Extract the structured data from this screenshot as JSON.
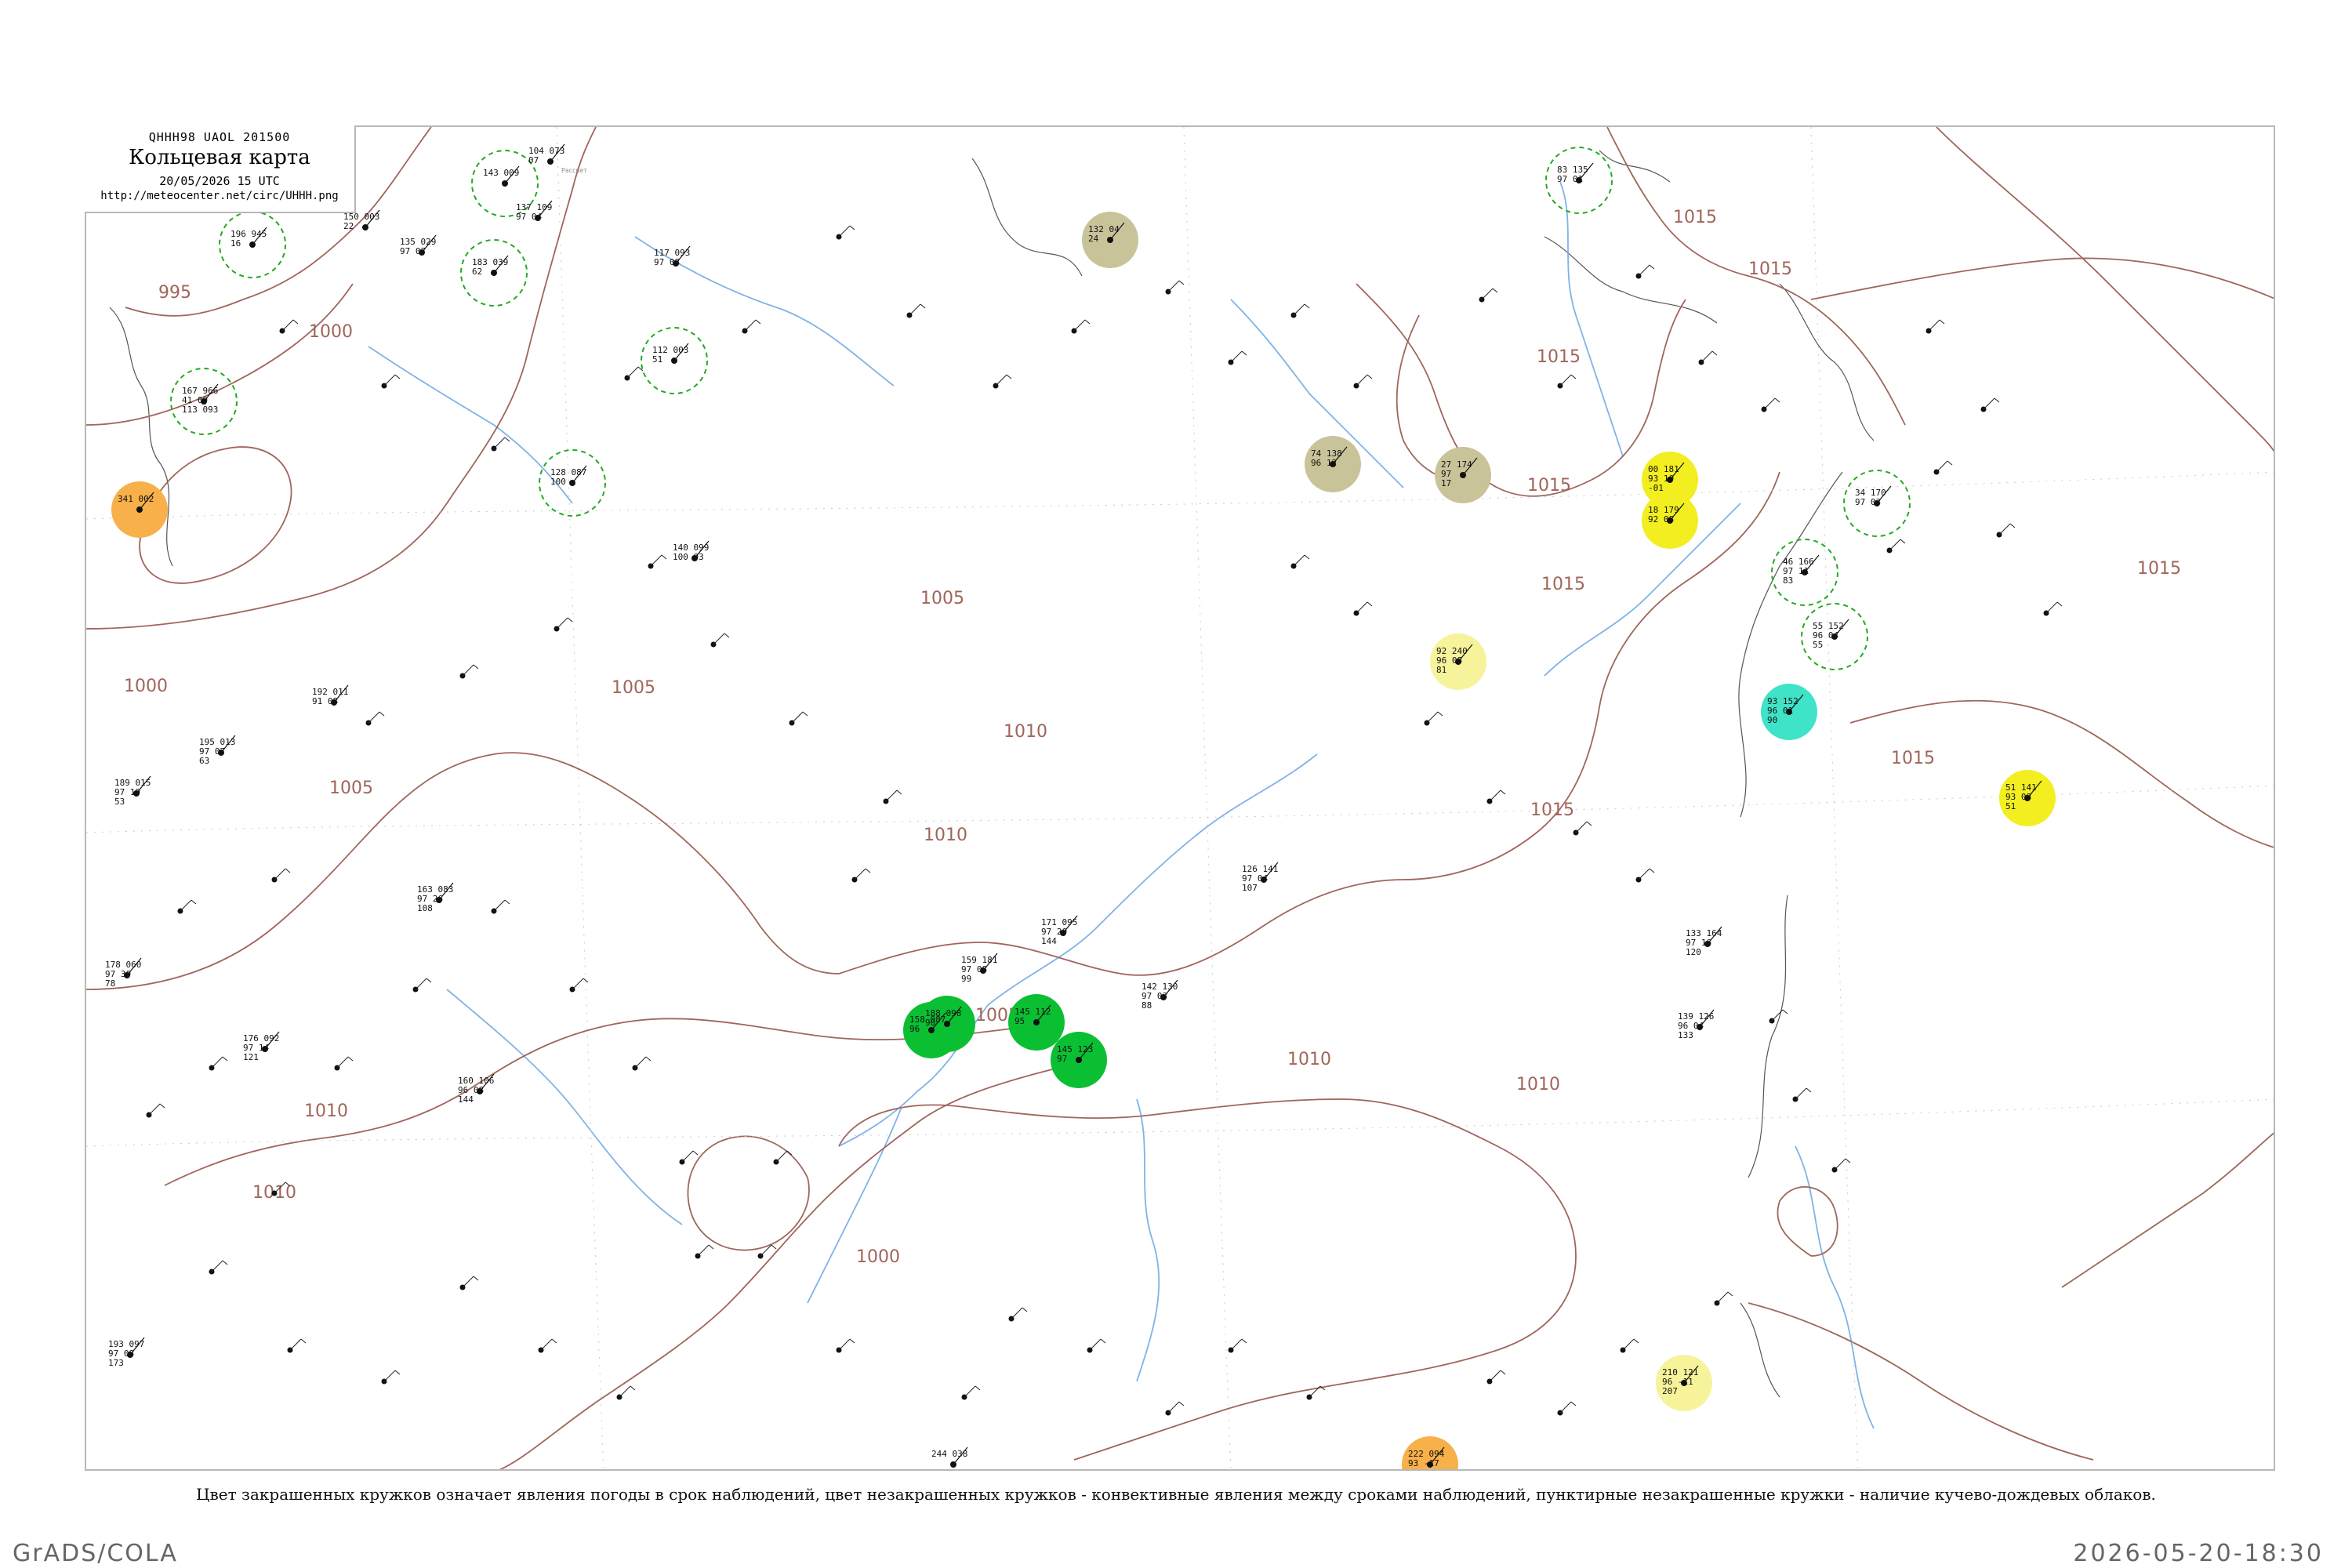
{
  "header": {
    "code": "QHHH98  UAOL  201500",
    "title": "Кольцевая карта",
    "datetime": "20/05/2026 15 UTC",
    "url": "http://meteocenter.net/circ/UHHH.png"
  },
  "caption": "Цвет закрашенных кружков означает явления погоды в срок наблюдений, цвет незакрашенных кружков - конвективные явления между сроками наблюдений, пунктирные незакрашенные кружки - наличие кучево-дождевых облаков.",
  "footer": {
    "left": "GrADS/COLA",
    "right": "2026-05-20-18:30"
  },
  "colors": {
    "isobar": "#a0655a",
    "river": "#7fb3e6",
    "coast": "#555555",
    "rain": "#0bbf32",
    "fog": "#c9c39a",
    "haze": "#f7f39a",
    "snow": "#f2ee20",
    "orange": "#f7b04a",
    "cyan": "#3fe3c8",
    "cb_outline": "#22aa22"
  },
  "isobar_labels": [
    "995",
    "1000",
    "1000",
    "1005",
    "1005",
    "1005",
    "1005",
    "1010",
    "1010",
    "1010",
    "1010",
    "1010",
    "1010",
    "1015",
    "1015",
    "1015",
    "1015",
    "1015",
    "1015",
    "1015",
    "1015",
    "1000"
  ],
  "stations": [
    {
      "id": "s01",
      "line1": "341 002",
      "line2": "",
      "line3": "",
      "name": "",
      "weather": "orange"
    },
    {
      "id": "s02",
      "line1": "196 945",
      "line2": "16",
      "line3": "",
      "name": "",
      "weather": "cb"
    },
    {
      "id": "s03",
      "line1": "143 009",
      "line2": "",
      "line3": "",
      "name": "",
      "weather": "cb"
    },
    {
      "id": "s04",
      "line1": "183 039",
      "line2": "62",
      "line3": "",
      "name": "",
      "weather": "cb"
    },
    {
      "id": "s05",
      "line1": "167 966",
      "line2": "41 09",
      "line3": "113 093",
      "name": "",
      "weather": "cb"
    },
    {
      "id": "s06",
      "line1": "112 003",
      "line2": "51",
      "line3": "",
      "name": "",
      "weather": "cb"
    },
    {
      "id": "s07",
      "line1": "128 087",
      "line2": "100",
      "line3": "",
      "name": "",
      "weather": "cb"
    },
    {
      "id": "s08",
      "line1": "132 04",
      "line2": "24",
      "line3": "",
      "name": "",
      "weather": "fog"
    },
    {
      "id": "s09",
      "line1": "74 138",
      "line2": "96 12",
      "line3": "",
      "name": "",
      "weather": "fog"
    },
    {
      "id": "s10",
      "line1": "27 174",
      "line2": "97",
      "line3": "17",
      "name": "",
      "weather": "fog"
    },
    {
      "id": "s11",
      "line1": "83 135",
      "line2": "97 01",
      "line3": "",
      "name": "",
      "weather": "cb"
    },
    {
      "id": "s12",
      "line1": "00 181",
      "line2": "93 10",
      "line3": "-01",
      "name": "",
      "weather": "snow"
    },
    {
      "id": "s13",
      "line1": "18 179",
      "line2": "92 08",
      "line3": "",
      "name": "",
      "weather": "snow"
    },
    {
      "id": "s14",
      "line1": "34 170",
      "line2": "97 03",
      "line3": "",
      "name": "",
      "weather": "cb"
    },
    {
      "id": "s15",
      "line1": "46 166",
      "line2": "97 11",
      "line3": "83",
      "name": "",
      "weather": "cb"
    },
    {
      "id": "s16",
      "line1": "55 152",
      "line2": "96 04",
      "line3": "55",
      "name": "",
      "weather": "cb"
    },
    {
      "id": "s17",
      "line1": "92 240",
      "line2": "96 08",
      "line3": "81",
      "name": "",
      "weather": "haze"
    },
    {
      "id": "s18",
      "line1": "93 152",
      "line2": "96 01",
      "line3": "90",
      "name": "",
      "weather": "cyan"
    },
    {
      "id": "s19",
      "line1": "51 141",
      "line2": "93 08",
      "line3": "51",
      "name": "",
      "weather": "snow"
    },
    {
      "id": "s20",
      "line1": "210 121",
      "line2": "96 -11",
      "line3": "207",
      "name": "",
      "weather": "haze"
    },
    {
      "id": "s21",
      "line1": "222 094",
      "line2": "93 -17",
      "line3": "",
      "name": "",
      "weather": "orange"
    },
    {
      "id": "s22",
      "line1": "188 098",
      "line2": "90",
      "line3": "",
      "name": "",
      "weather": "rain"
    },
    {
      "id": "s23",
      "line1": "158 087",
      "line2": "96",
      "line3": "",
      "name": "",
      "weather": "rain"
    },
    {
      "id": "s24",
      "line1": "145 123",
      "line2": "97",
      "line3": "",
      "name": "",
      "weather": "rain"
    },
    {
      "id": "s25",
      "line1": "171 095",
      "line2": "97 20",
      "line3": "144",
      "name": "",
      "weather": "none"
    },
    {
      "id": "s26",
      "line1": "159 181",
      "line2": "97 08",
      "line3": "99",
      "name": "",
      "weather": "none"
    },
    {
      "id": "s27",
      "line1": "145 112",
      "line2": "95",
      "line3": "",
      "name": "",
      "weather": "rain"
    },
    {
      "id": "s28",
      "line1": "140 099",
      "line2": "100 03",
      "line3": "",
      "name": "",
      "weather": "none"
    },
    {
      "id": "s29",
      "line1": "104 073",
      "line2": "07",
      "line3": "",
      "name": "Рассвет",
      "weather": "none"
    },
    {
      "id": "s30",
      "line1": "150 003",
      "line2": "22",
      "line3": "",
      "name": "",
      "weather": "none"
    },
    {
      "id": "s31",
      "line1": "135 029",
      "line2": "97 07",
      "line3": "",
      "name": "",
      "weather": "none"
    },
    {
      "id": "s32",
      "line1": "137 109",
      "line2": "97 04",
      "line3": "",
      "name": "",
      "weather": "none"
    },
    {
      "id": "s33",
      "line1": "117 093",
      "line2": "97 08",
      "line3": "",
      "name": "",
      "weather": "none"
    },
    {
      "id": "s34",
      "line1": "160 106",
      "line2": "96 08",
      "line3": "144",
      "name": "",
      "weather": "none"
    },
    {
      "id": "s35",
      "line1": "178 060",
      "line2": "97 30",
      "line3": "78",
      "name": "",
      "weather": "none"
    },
    {
      "id": "s36",
      "line1": "189 015",
      "line2": "97 19",
      "line3": "53",
      "name": "",
      "weather": "none"
    },
    {
      "id": "s37",
      "line1": "195 013",
      "line2": "97 07",
      "line3": "63",
      "name": "",
      "weather": "none"
    },
    {
      "id": "s38",
      "line1": "192 011",
      "line2": "91 08",
      "line3": "",
      "name": "",
      "weather": "none"
    },
    {
      "id": "s39",
      "line1": "163 083",
      "line2": "97 26",
      "line3": "108",
      "name": "",
      "weather": "none"
    },
    {
      "id": "s40",
      "line1": "176 092",
      "line2": "97 14",
      "line3": "121",
      "name": "",
      "weather": "none"
    },
    {
      "id": "s41",
      "line1": "142 130",
      "line2": "97 03",
      "line3": "88",
      "name": "",
      "weather": "none"
    },
    {
      "id": "s42",
      "line1": "126 141",
      "line2": "97 04",
      "line3": "107",
      "name": "",
      "weather": "none"
    },
    {
      "id": "s43",
      "line1": "133 164",
      "line2": "97 16",
      "line3": "120",
      "name": "",
      "weather": "none"
    },
    {
      "id": "s44",
      "line1": "139 126",
      "line2": "96 04",
      "line3": "133",
      "name": "",
      "weather": "none"
    },
    {
      "id": "s45",
      "line1": "244 038",
      "line2": "",
      "line3": "",
      "name": "",
      "weather": "none"
    },
    {
      "id": "s46",
      "line1": "193 097",
      "line2": "97 08",
      "line3": "173",
      "name": "",
      "weather": "none"
    }
  ]
}
